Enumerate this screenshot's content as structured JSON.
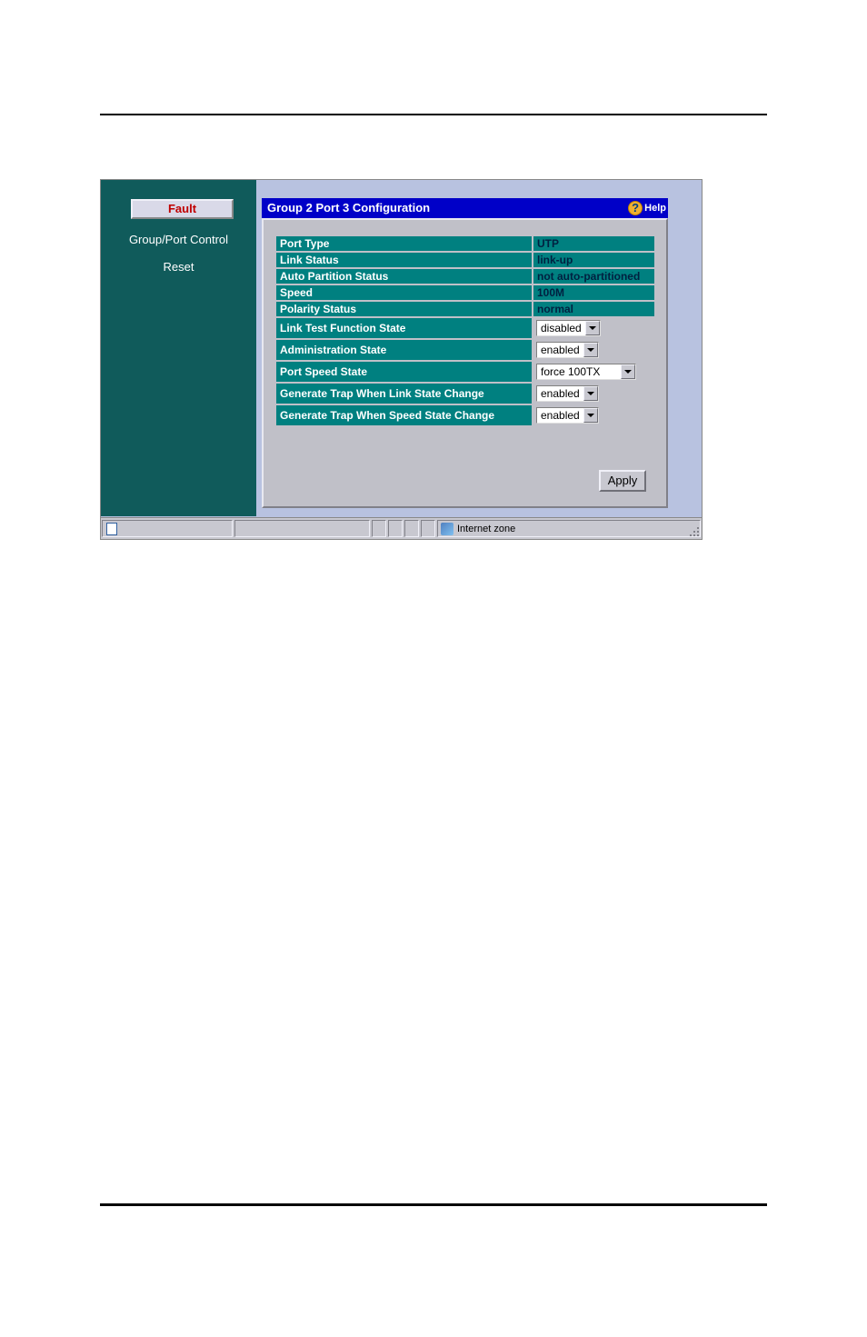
{
  "sidebar": {
    "fault_label": "Fault",
    "items": [
      "Group/Port Control",
      "Reset"
    ]
  },
  "header": {
    "title": "Group 2 Port 3 Configuration",
    "help_label": "Help"
  },
  "config": {
    "rows_static": [
      {
        "label": "Port Type",
        "value": "UTP"
      },
      {
        "label": "Link Status",
        "value": "link-up"
      },
      {
        "label": "Auto Partition Status",
        "value": "not auto-partitioned"
      },
      {
        "label": "Speed",
        "value": "100M"
      },
      {
        "label": "Polarity Status",
        "value": "normal"
      }
    ],
    "rows_select": [
      {
        "label": "Link Test Function State",
        "value": "disabled",
        "wide": false
      },
      {
        "label": "Administration State",
        "value": "enabled",
        "wide": false
      },
      {
        "label": "Port Speed State",
        "value": "force 100TX",
        "wide": true
      },
      {
        "label": "Generate Trap When Link State Change",
        "value": "enabled",
        "wide": false
      },
      {
        "label": "Generate Trap When Speed State Change",
        "value": "enabled",
        "wide": false
      }
    ]
  },
  "buttons": {
    "apply": "Apply"
  },
  "statusbar": {
    "zone": "Internet zone"
  }
}
